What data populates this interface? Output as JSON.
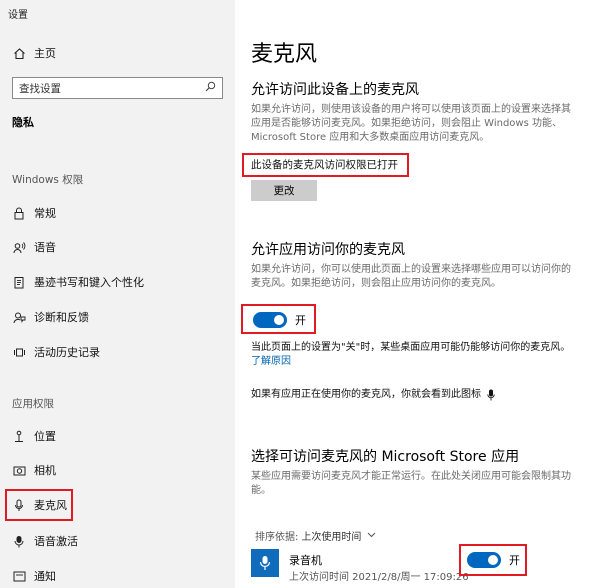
{
  "window_title": "设置",
  "sidebar": {
    "home": "主页",
    "search_placeholder": "查找设置",
    "privacy": "隐私",
    "windows_section": "Windows 权限",
    "windows_items": [
      "常规",
      "语音",
      "墨迹书写和键入个性化",
      "诊断和反馈",
      "活动历史记录"
    ],
    "app_section": "应用权限",
    "app_items": [
      "位置",
      "相机",
      "麦克风",
      "语音激活",
      "通知"
    ]
  },
  "main": {
    "title": "麦克风",
    "device_section": {
      "heading": "允许访问此设备上的麦克风",
      "desc_lines": [
        "如果允许访问，则使用该设备的用户将可以使用该页面上的设置来选择其",
        "应用是否能够访问麦克风。如果拒绝访问，则会阻止 Windows 功能、",
        "Microsoft Store 应用和大多数桌面应用访问麦克风。"
      ],
      "status": "此设备的麦克风访问权限已打开",
      "change_button": "更改"
    },
    "app_access_section": {
      "heading": "允许应用访问你的麦克风",
      "desc_lines": [
        "如果允许访问，你可以使用此页面上的设置来选择哪些应用可以访问你的",
        "麦克风。如果拒绝访问，则会阻止应用访问你的麦克风。"
      ],
      "toggle_label": "开",
      "note": "当此页面上的设置为\"关\"时，某些桌面应用可能仍能够访问你的麦克风。",
      "learn_more": "了解原因",
      "in_use_note": "如果有应用正在使用你的麦克风，你就会看到此图标"
    },
    "store_section": {
      "heading": "选择可访问麦克风的 Microsoft Store 应用",
      "desc_lines": [
        "某些应用需要访问麦克风才能正常运行。在此处关闭应用可能会限制其功",
        "能。"
      ],
      "sort_label": "排序依据:",
      "sort_value": "上次使用时间",
      "apps": [
        {
          "name": "录音机",
          "last_access": "上次访问时间 2021/2/8/周一 17:09:26",
          "toggle_label": "开"
        }
      ]
    }
  }
}
